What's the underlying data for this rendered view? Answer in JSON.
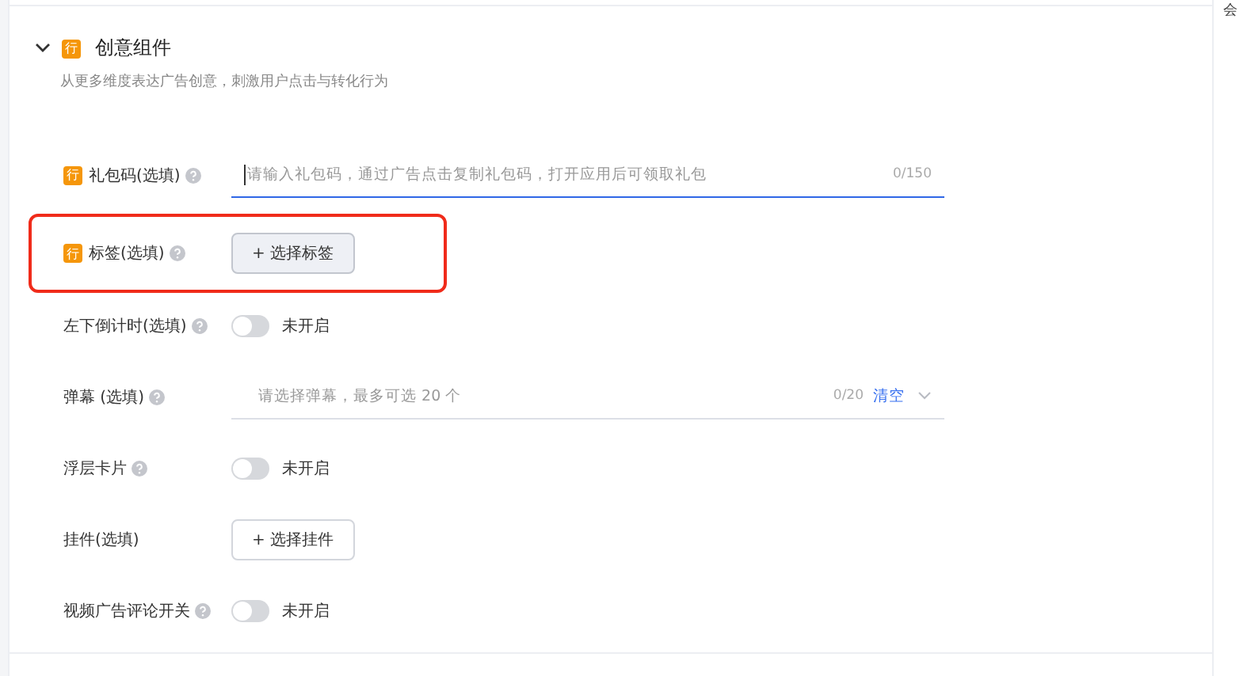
{
  "section": {
    "expanded": true,
    "badge": "行",
    "title": "创意组件",
    "subtitle": "从更多维度表达广告创意，刺激用户点击与转化行为"
  },
  "fields": [
    {
      "kind": "input",
      "badge": "行",
      "label": "礼包码(选填)",
      "help": true,
      "highlighted": false,
      "placeholder": "请输入礼包码，通过广告点击复制礼包码，打开应用后可领取礼包",
      "count": "0/150",
      "focused": true
    },
    {
      "kind": "button",
      "badge": "行",
      "label": "标签(选填)",
      "help": true,
      "highlighted": true,
      "button": "+ 选择标签",
      "hover": true
    },
    {
      "kind": "switch",
      "label": "左下倒计时(选填)",
      "help": true,
      "highlighted": false,
      "on": false,
      "state": "未开启"
    },
    {
      "kind": "select",
      "label": "弹幕 (选填)",
      "help": true,
      "highlighted": false,
      "placeholder": "请选择弹幕，最多可选 20 个",
      "count": "0/20",
      "clear": "清空"
    },
    {
      "kind": "switch",
      "label": "浮层卡片",
      "help": true,
      "highlighted": false,
      "on": false,
      "state": "未开启"
    },
    {
      "kind": "button",
      "label": "挂件(选填)",
      "help": false,
      "highlighted": false,
      "button": "+ 选择挂件",
      "hover": false
    },
    {
      "kind": "switch",
      "label": "视频广告评论开关",
      "help": true,
      "highlighted": false,
      "on": false,
      "state": "未开启"
    }
  ],
  "side": {
    "text": "会"
  }
}
